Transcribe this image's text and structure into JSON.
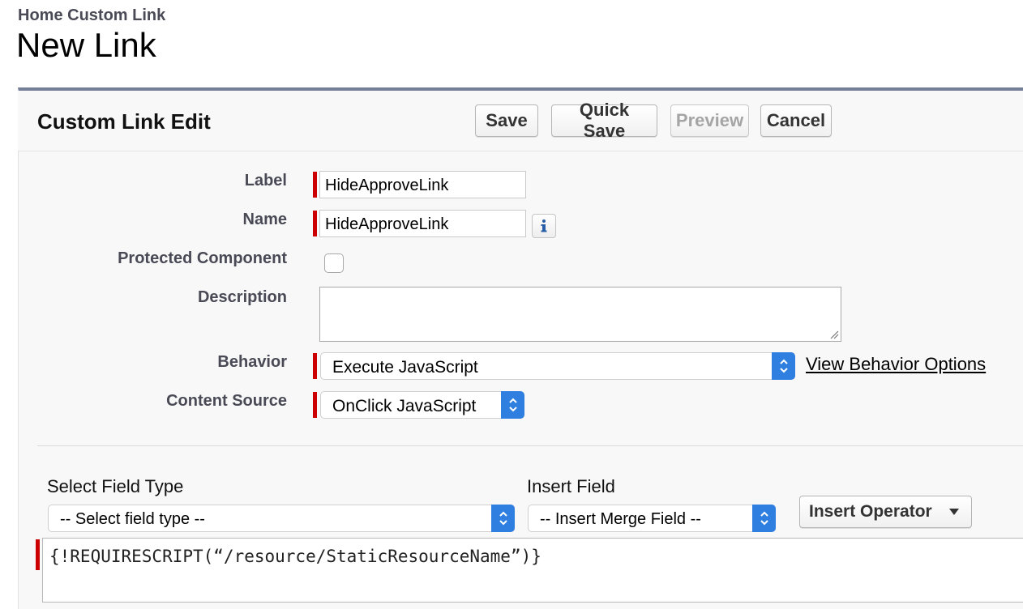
{
  "header": {
    "breadcrumb": "Home Custom Link",
    "title": "New Link"
  },
  "panel": {
    "title": "Custom Link Edit",
    "buttons": {
      "save": "Save",
      "quick_save": "Quick Save",
      "preview": "Preview",
      "cancel": "Cancel"
    }
  },
  "form": {
    "label": {
      "label": "Label",
      "value": "HideApproveLink"
    },
    "name": {
      "label": "Name",
      "value": "HideApproveLink"
    },
    "protected": {
      "label": "Protected Component",
      "checked": false
    },
    "description": {
      "label": "Description",
      "value": ""
    },
    "behavior": {
      "label": "Behavior",
      "value": "Execute JavaScript",
      "link": "View Behavior Options"
    },
    "content_source": {
      "label": "Content Source",
      "value": "OnClick JavaScript"
    }
  },
  "editor": {
    "field_type_label": "Select Field Type",
    "field_type_value": "-- Select field type --",
    "insert_field_label": "Insert Field",
    "insert_field_value": "-- Insert Merge Field --",
    "insert_operator": "Insert Operator",
    "code": "{!REQUIRESCRIPT(“/resource/StaticResourceName”)}"
  },
  "colors": {
    "required": "#cc0000",
    "select_accent": "#2f7fe0",
    "panel_top_border": "#747e96"
  },
  "icons": {
    "info": "info-icon",
    "select_arrows": "updown-chevron-icon",
    "dropdown": "caret-down-icon",
    "resize": "resize-grip-icon"
  }
}
